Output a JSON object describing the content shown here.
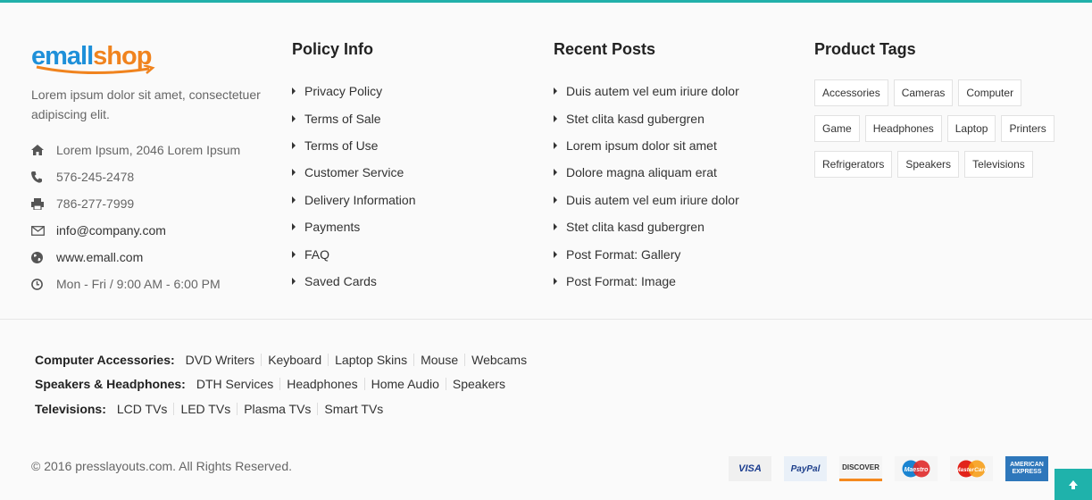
{
  "logo": {
    "part1": "emall",
    "part2": "shop"
  },
  "about": {
    "text": "Lorem ipsum dolor sit amet, consectetuer adipiscing elit."
  },
  "contact": {
    "address": "Lorem Ipsum, 2046 Lorem Ipsum",
    "phone": "576-245-2478",
    "fax": "786-277-7999",
    "email": "info@company.com",
    "website": "www.emall.com",
    "hours": "Mon - Fri / 9:00 AM - 6:00 PM"
  },
  "policy": {
    "title": "Policy Info",
    "items": [
      "Privacy Policy",
      "Terms of Sale",
      "Terms of Use",
      "Customer Service",
      "Delivery Information",
      "Payments",
      "FAQ",
      "Saved Cards"
    ]
  },
  "recent": {
    "title": "Recent Posts",
    "items": [
      "Duis autem vel eum iriure dolor",
      "Stet clita kasd gubergren",
      "Lorem ipsum dolor sit amet",
      "Dolore magna aliquam erat",
      "Duis autem vel eum iriure dolor",
      "Stet clita kasd gubergren",
      "Post Format: Gallery",
      "Post Format: Image"
    ]
  },
  "tags": {
    "title": "Product Tags",
    "items": [
      "Accessories",
      "Cameras",
      "Computer",
      "Game",
      "Headphones",
      "Laptop",
      "Printers",
      "Refrigerators",
      "Speakers",
      "Televisions"
    ]
  },
  "categories": [
    {
      "title": "Computer Accessories:",
      "items": [
        "DVD Writers",
        "Keyboard",
        "Laptop Skins",
        "Mouse",
        "Webcams"
      ]
    },
    {
      "title": "Speakers & Headphones:",
      "items": [
        "DTH Services",
        "Headphones",
        "Home Audio",
        "Speakers"
      ]
    },
    {
      "title": "Televisions:",
      "items": [
        "LCD TVs",
        "LED TVs",
        "Plasma TVs",
        "Smart TVs"
      ]
    }
  ],
  "copyright": "© 2016 presslayouts.com. All Rights Reserved.",
  "payments": {
    "visa": "VISA",
    "paypal": "PayPal",
    "discover": "DISCOVER",
    "maestro": "Maestro",
    "mastercard": "MasterCard",
    "amex": "AMERICAN EXPRESS"
  },
  "colors": {
    "accent": "#21b0aa",
    "logo_blue": "#1e90d9",
    "logo_orange": "#f0831e"
  },
  "icons": {
    "back_to_top": "arrow-up-icon"
  }
}
